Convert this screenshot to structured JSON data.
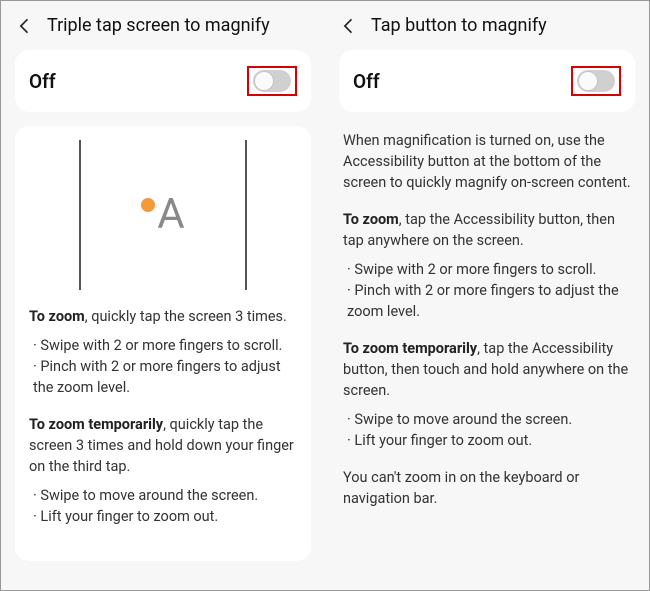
{
  "left": {
    "title": "Triple tap screen to magnify",
    "toggle_label": "Off",
    "illustration_letter": "A",
    "zoom_heading": "To zoom",
    "zoom_text": ", quickly tap the screen 3 times.",
    "zoom_b1": "· Swipe with 2 or more fingers to scroll.",
    "zoom_b2": "· Pinch with 2 or more fingers to adjust the zoom level.",
    "temp_heading": "To zoom temporarily",
    "temp_text": ", quickly tap the screen 3 times and hold down your finger on the third tap.",
    "temp_b1": "· Swipe to move around the screen.",
    "temp_b2": "· Lift your finger to zoom out."
  },
  "right": {
    "title": "Tap button to magnify",
    "toggle_label": "Off",
    "intro": "When magnification is turned on, use the Accessibility button at the bottom of the screen to quickly magnify on-screen content.",
    "zoom_heading": "To zoom",
    "zoom_text": ", tap the Accessibility button, then tap anywhere on the screen.",
    "zoom_b1": "· Swipe with 2 or more fingers to scroll.",
    "zoom_b2": "· Pinch with 2 or more fingers to adjust the zoom level.",
    "temp_heading": "To zoom temporarily",
    "temp_text": ", tap the Accessibility button, then touch and hold anywhere on the screen.",
    "temp_b1": "· Swipe to move around the screen.",
    "temp_b2": "· Lift your finger to zoom out.",
    "footer": "You can't zoom in on the keyboard or navigation bar."
  }
}
